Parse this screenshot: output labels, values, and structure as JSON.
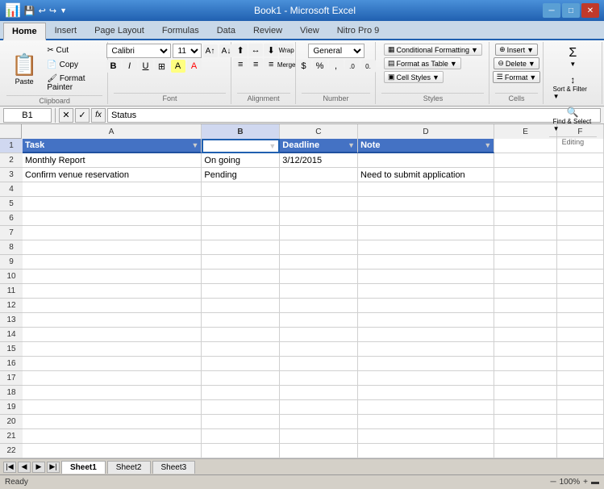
{
  "titleBar": {
    "title": "Book1 - Microsoft Excel",
    "minBtn": "─",
    "maxBtn": "□",
    "closeBtn": "✕"
  },
  "tabs": [
    {
      "label": "Home",
      "active": true
    },
    {
      "label": "Insert",
      "active": false
    },
    {
      "label": "Page Layout",
      "active": false
    },
    {
      "label": "Formulas",
      "active": false
    },
    {
      "label": "Data",
      "active": false
    },
    {
      "label": "Review",
      "active": false
    },
    {
      "label": "View",
      "active": false
    },
    {
      "label": "Nitro Pro 9",
      "active": false
    }
  ],
  "ribbon": {
    "clipboardLabel": "Clipboard",
    "fontLabel": "Font",
    "alignmentLabel": "Alignment",
    "numberLabel": "Number",
    "stylesLabel": "Styles",
    "cellsLabel": "Cells",
    "editingLabel": "Editing",
    "pasteLabel": "Paste",
    "fontName": "Calibri",
    "fontSize": "11",
    "numberFormat": "General",
    "boldLabel": "B",
    "italicLabel": "I",
    "underlineLabel": "U",
    "conditionalFormatLabel": "Conditional Formatting",
    "formatAsTableLabel": "Format as Table",
    "cellStylesLabel": "Cell Styles",
    "insertLabel": "Insert",
    "deleteLabel": "Delete",
    "formatLabel": "Format",
    "sumLabel": "Σ",
    "sortFilterLabel": "Sort &\nFilter",
    "findSelectLabel": "Find &\nSelect"
  },
  "formulaBar": {
    "cellRef": "B1",
    "formula": "Status"
  },
  "colHeaders": [
    "A",
    "B",
    "C",
    "D",
    "E",
    "F"
  ],
  "rows": [
    {
      "rowNum": 1,
      "cells": [
        {
          "value": "Task",
          "isHeader": true,
          "hasDropdown": true
        },
        {
          "value": "Status",
          "isHeader": true,
          "hasDropdown": true,
          "isSelected": true
        },
        {
          "value": "Deadline",
          "isHeader": true,
          "hasDropdown": true
        },
        {
          "value": "Note",
          "isHeader": true,
          "hasDropdown": true
        },
        {
          "value": ""
        },
        {
          "value": ""
        }
      ]
    },
    {
      "rowNum": 2,
      "cells": [
        {
          "value": "Monthly Report"
        },
        {
          "value": "On going"
        },
        {
          "value": "3/12/2015"
        },
        {
          "value": ""
        },
        {
          "value": ""
        },
        {
          "value": ""
        }
      ]
    },
    {
      "rowNum": 3,
      "cells": [
        {
          "value": "Confirm venue reservation"
        },
        {
          "value": "Pending"
        },
        {
          "value": ""
        },
        {
          "value": "Need to submit application"
        },
        {
          "value": ""
        },
        {
          "value": ""
        }
      ]
    },
    {
      "rowNum": 4,
      "cells": [
        {
          "value": ""
        },
        {
          "value": ""
        },
        {
          "value": ""
        },
        {
          "value": ""
        },
        {
          "value": ""
        },
        {
          "value": ""
        }
      ]
    },
    {
      "rowNum": 5,
      "cells": [
        {
          "value": ""
        },
        {
          "value": ""
        },
        {
          "value": ""
        },
        {
          "value": ""
        },
        {
          "value": ""
        },
        {
          "value": ""
        }
      ]
    },
    {
      "rowNum": 6,
      "cells": [
        {
          "value": ""
        },
        {
          "value": ""
        },
        {
          "value": ""
        },
        {
          "value": ""
        },
        {
          "value": ""
        },
        {
          "value": ""
        }
      ]
    },
    {
      "rowNum": 7,
      "cells": [
        {
          "value": ""
        },
        {
          "value": ""
        },
        {
          "value": ""
        },
        {
          "value": ""
        },
        {
          "value": ""
        },
        {
          "value": ""
        }
      ]
    },
    {
      "rowNum": 8,
      "cells": [
        {
          "value": ""
        },
        {
          "value": ""
        },
        {
          "value": ""
        },
        {
          "value": ""
        },
        {
          "value": ""
        },
        {
          "value": ""
        }
      ]
    },
    {
      "rowNum": 9,
      "cells": [
        {
          "value": ""
        },
        {
          "value": ""
        },
        {
          "value": ""
        },
        {
          "value": ""
        },
        {
          "value": ""
        },
        {
          "value": ""
        }
      ]
    },
    {
      "rowNum": 10,
      "cells": [
        {
          "value": ""
        },
        {
          "value": ""
        },
        {
          "value": ""
        },
        {
          "value": ""
        },
        {
          "value": ""
        },
        {
          "value": ""
        }
      ]
    },
    {
      "rowNum": 11,
      "cells": [
        {
          "value": ""
        },
        {
          "value": ""
        },
        {
          "value": ""
        },
        {
          "value": ""
        },
        {
          "value": ""
        },
        {
          "value": ""
        }
      ]
    },
    {
      "rowNum": 12,
      "cells": [
        {
          "value": ""
        },
        {
          "value": ""
        },
        {
          "value": ""
        },
        {
          "value": ""
        },
        {
          "value": ""
        },
        {
          "value": ""
        }
      ]
    },
    {
      "rowNum": 13,
      "cells": [
        {
          "value": ""
        },
        {
          "value": ""
        },
        {
          "value": ""
        },
        {
          "value": ""
        },
        {
          "value": ""
        },
        {
          "value": ""
        }
      ]
    },
    {
      "rowNum": 14,
      "cells": [
        {
          "value": ""
        },
        {
          "value": ""
        },
        {
          "value": ""
        },
        {
          "value": ""
        },
        {
          "value": ""
        },
        {
          "value": ""
        }
      ]
    },
    {
      "rowNum": 15,
      "cells": [
        {
          "value": ""
        },
        {
          "value": ""
        },
        {
          "value": ""
        },
        {
          "value": ""
        },
        {
          "value": ""
        },
        {
          "value": ""
        }
      ]
    },
    {
      "rowNum": 16,
      "cells": [
        {
          "value": ""
        },
        {
          "value": ""
        },
        {
          "value": ""
        },
        {
          "value": ""
        },
        {
          "value": ""
        },
        {
          "value": ""
        }
      ]
    },
    {
      "rowNum": 17,
      "cells": [
        {
          "value": ""
        },
        {
          "value": ""
        },
        {
          "value": ""
        },
        {
          "value": ""
        },
        {
          "value": ""
        },
        {
          "value": ""
        }
      ]
    },
    {
      "rowNum": 18,
      "cells": [
        {
          "value": ""
        },
        {
          "value": ""
        },
        {
          "value": ""
        },
        {
          "value": ""
        },
        {
          "value": ""
        },
        {
          "value": ""
        }
      ]
    },
    {
      "rowNum": 19,
      "cells": [
        {
          "value": ""
        },
        {
          "value": ""
        },
        {
          "value": ""
        },
        {
          "value": ""
        },
        {
          "value": ""
        },
        {
          "value": ""
        }
      ]
    },
    {
      "rowNum": 20,
      "cells": [
        {
          "value": ""
        },
        {
          "value": ""
        },
        {
          "value": ""
        },
        {
          "value": ""
        },
        {
          "value": ""
        },
        {
          "value": ""
        }
      ]
    },
    {
      "rowNum": 21,
      "cells": [
        {
          "value": ""
        },
        {
          "value": ""
        },
        {
          "value": ""
        },
        {
          "value": ""
        },
        {
          "value": ""
        },
        {
          "value": ""
        }
      ]
    },
    {
      "rowNum": 22,
      "cells": [
        {
          "value": ""
        },
        {
          "value": ""
        },
        {
          "value": ""
        },
        {
          "value": ""
        },
        {
          "value": ""
        },
        {
          "value": ""
        }
      ]
    }
  ],
  "sheetTabs": [
    {
      "label": "Sheet1",
      "active": true
    },
    {
      "label": "Sheet2",
      "active": false
    },
    {
      "label": "Sheet3",
      "active": false
    }
  ],
  "statusBar": {
    "ready": "Ready",
    "zoom": "100%"
  }
}
